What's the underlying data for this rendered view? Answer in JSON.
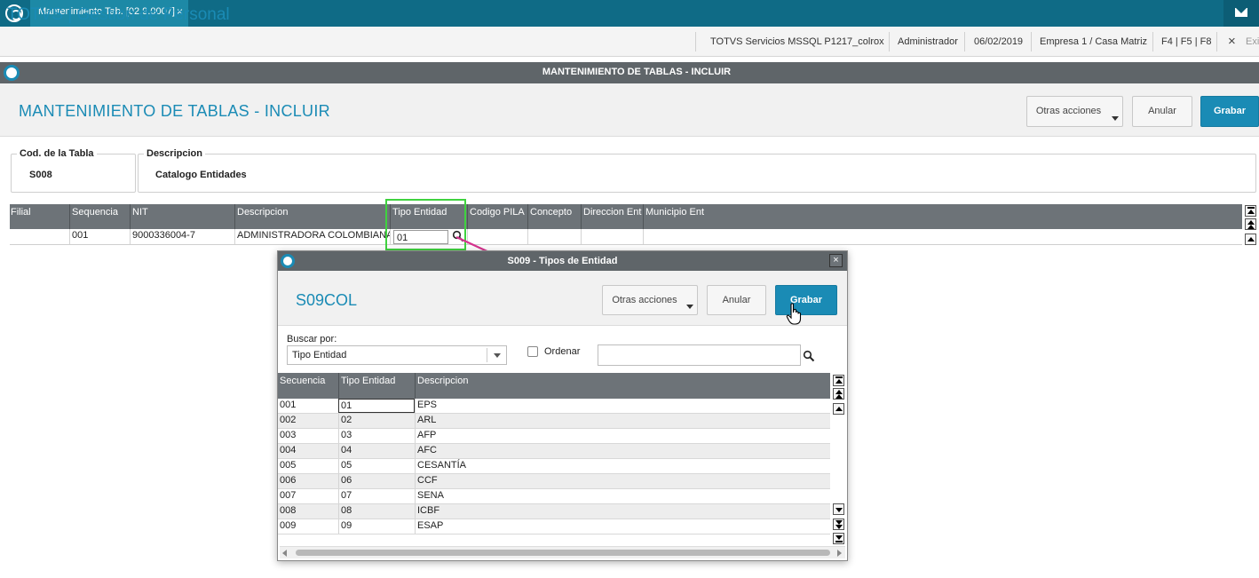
{
  "tabbar": {
    "tab_title": "Mantenimiento Tab. [02.9.0007]",
    "tab_close": "×"
  },
  "header": {
    "app_title": "TOTVS | Gestion de Personal",
    "server": "TOTVS Servicios MSSQL P1217_colrox",
    "user": "Administrador",
    "date": "06/02/2019",
    "company": "Empresa 1 / Casa Matriz",
    "shortcuts": "F4 | F5 | F8",
    "exit_icon": "×",
    "exit_label": "Exi"
  },
  "main": {
    "window_title": "MANTENIMIENTO DE TABLAS - INCLUIR",
    "page_title": "MANTENIMIENTO DE TABLAS - INCLUIR",
    "buttons": {
      "other_actions": "Otras acciones",
      "cancel": "Anular",
      "save": "Grabar"
    },
    "fields": {
      "table_code_label": "Cod. de la Tabla",
      "table_code_value": "S008",
      "description_label": "Descripcion",
      "description_value": "Catalogo Entidades"
    },
    "grid": {
      "columns": [
        "Filial",
        "Sequencia",
        "NIT",
        "Descripcion",
        "Tipo Entidad",
        "Codigo PILA",
        "Concepto",
        "Direccion Ent",
        "Municipio Ent"
      ],
      "row": {
        "filial": "",
        "sequencia": "001",
        "nit": "9000336004-7",
        "descripcion": "ADMINISTRADORA COLOMBIANA",
        "tipo_entidad": "01",
        "codigo_pila": "",
        "concepto": "",
        "direccion": "",
        "municipio": ""
      }
    }
  },
  "dialog": {
    "title": "S009 - Tipos de Entidad",
    "close": "×",
    "heading": "S09COL",
    "buttons": {
      "other_actions": "Otras acciones",
      "cancel": "Anular",
      "save": "Grabar"
    },
    "search_by_label": "Buscar por:",
    "search_by_value": "Tipo Entidad",
    "order_label": "Ordenar",
    "order_checked": false,
    "search_value": "",
    "grid": {
      "columns": [
        "Secuencia",
        "Tipo Entidad",
        "Descripcion"
      ],
      "rows": [
        {
          "seq": "001",
          "tipo": "01",
          "desc": "EPS"
        },
        {
          "seq": "002",
          "tipo": "02",
          "desc": "ARL"
        },
        {
          "seq": "003",
          "tipo": "03",
          "desc": "AFP"
        },
        {
          "seq": "004",
          "tipo": "04",
          "desc": "AFC"
        },
        {
          "seq": "005",
          "tipo": "05",
          "desc": "CESANTÍA"
        },
        {
          "seq": "006",
          "tipo": "06",
          "desc": "CCF"
        },
        {
          "seq": "007",
          "tipo": "07",
          "desc": "SENA"
        },
        {
          "seq": "008",
          "tipo": "08",
          "desc": "ICBF"
        },
        {
          "seq": "009",
          "tipo": "09",
          "desc": "ESAP"
        }
      ]
    }
  },
  "colors": {
    "brand": "#1a8bb5",
    "titlebar": "#5f6569",
    "grid_header": "#6d7378",
    "highlight": "#3fd23f",
    "arrow": "#d6338f"
  }
}
